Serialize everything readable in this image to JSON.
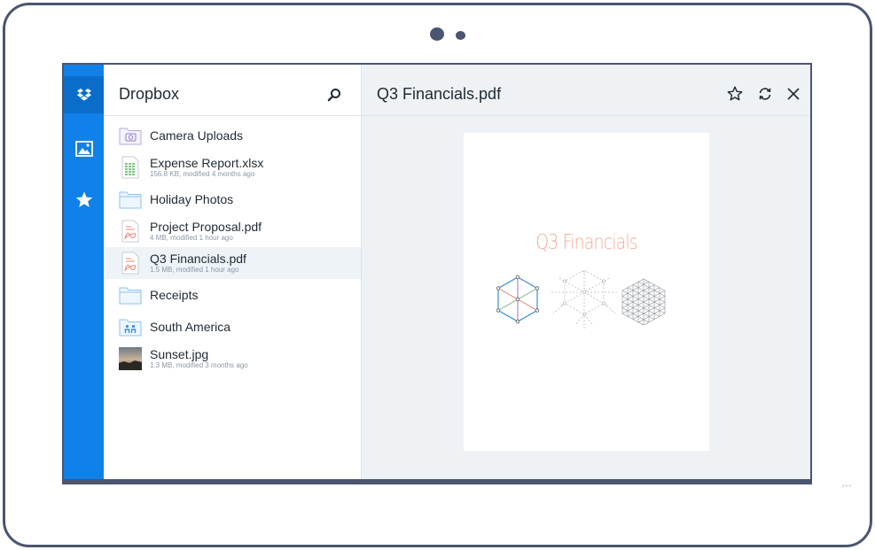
{
  "app": {
    "title": "Dropbox"
  },
  "rail": {
    "items": [
      {
        "icon": "dropbox-logo-icon",
        "active": true
      },
      {
        "icon": "photos-icon",
        "active": false
      },
      {
        "icon": "star-icon",
        "active": false
      }
    ]
  },
  "files": [
    {
      "name": "Camera Uploads",
      "meta": "",
      "icon": "camera-folder-icon"
    },
    {
      "name": "Expense Report.xlsx",
      "meta": "156.8 KB, modified 4 months ago",
      "icon": "spreadsheet-icon"
    },
    {
      "name": "Holiday Photos",
      "meta": "",
      "icon": "folder-icon"
    },
    {
      "name": "Project Proposal.pdf",
      "meta": "4 MB, modified 1 hour ago",
      "icon": "pdf-icon"
    },
    {
      "name": "Q3 Financials.pdf",
      "meta": "1.5 MB, modified 1 hour ago",
      "icon": "pdf-icon",
      "selected": true
    },
    {
      "name": "Receipts",
      "meta": "",
      "icon": "folder-icon"
    },
    {
      "name": "South America",
      "meta": "",
      "icon": "shared-folder-icon"
    },
    {
      "name": "Sunset.jpg",
      "meta": "1.3 MB, modified 3 months ago",
      "icon": "image-thumbnail-icon"
    }
  ],
  "viewer": {
    "title": "Q3 Financials.pdf",
    "document_title": "Q3 Financials"
  },
  "colors": {
    "rail": "#1081e8",
    "rail_active": "#0b6dca",
    "doc_title": "#f3ab95",
    "frame": "#4a5570"
  }
}
